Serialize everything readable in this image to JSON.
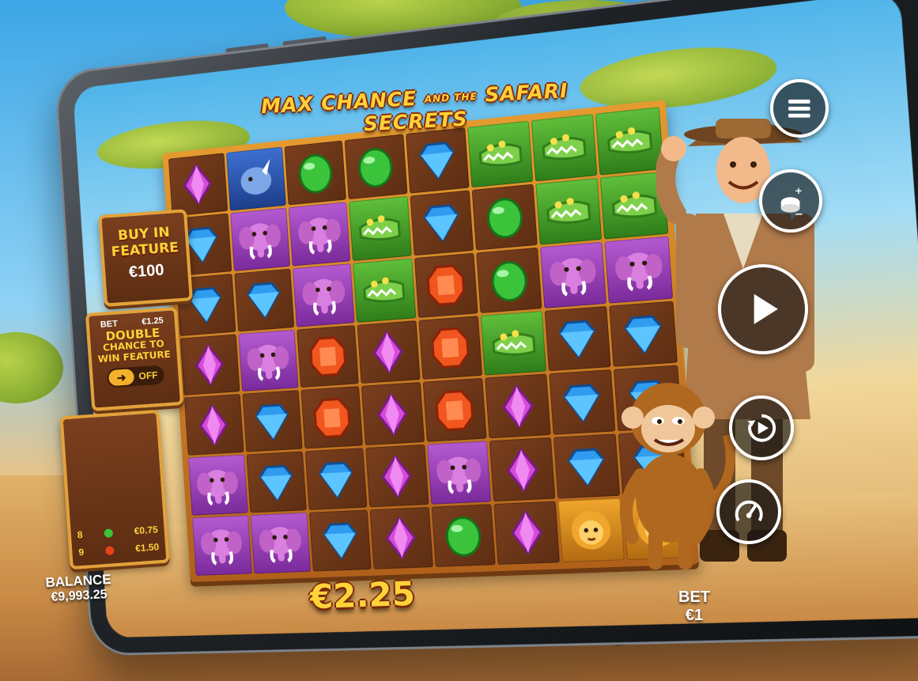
{
  "game": {
    "title_main": "MAX CHANCE",
    "title_and": "AND THE",
    "title_sub": "SAFARI SECRETS"
  },
  "buy_feature": {
    "label": "BUY IN FEATURE",
    "price": "€100"
  },
  "double_chance": {
    "bet_label": "BET",
    "bet_value": "€1.25",
    "label_line1": "DOUBLE",
    "label_line2": "CHANCE TO",
    "label_line3": "WIN FEATURE",
    "toggle_state": "OFF"
  },
  "paytable": {
    "rows": [
      {
        "count": "8",
        "gem": "green",
        "value": "€0.75"
      },
      {
        "count": "9",
        "gem": "red",
        "value": "€1.50"
      }
    ]
  },
  "hud": {
    "balance_label": "BALANCE",
    "balance_value": "€9,993.25",
    "win_value": "€2.25",
    "bet_label": "BET",
    "bet_value": "€1"
  },
  "controls": [
    {
      "name": "menu-button",
      "icon": "hamburger-icon"
    },
    {
      "name": "bet-adjust-button",
      "icon": "coin-stack-icon"
    },
    {
      "name": "spin-button",
      "icon": "play-icon"
    },
    {
      "name": "autoplay-button",
      "icon": "autoplay-icon"
    },
    {
      "name": "turbo-button",
      "icon": "speedometer-icon"
    }
  ],
  "grid": {
    "rows": [
      [
        "purple",
        "rhino",
        "green",
        "green",
        "blue",
        "croc",
        "croc",
        "croc"
      ],
      [
        "blue",
        "elephant",
        "elephant",
        "croc",
        "blue",
        "green",
        "croc",
        "croc"
      ],
      [
        "blue",
        "blue",
        "elephant",
        "croc",
        "red",
        "green",
        "elephant",
        "elephant"
      ],
      [
        "purple",
        "elephant",
        "red",
        "purple",
        "red",
        "croc",
        "blue",
        "blue"
      ],
      [
        "purple",
        "blue",
        "red",
        "purple",
        "red",
        "purple",
        "blue",
        "blue"
      ],
      [
        "elephant",
        "blue",
        "blue",
        "purple",
        "elephant",
        "purple",
        "blue",
        "blue"
      ],
      [
        "elephant",
        "elephant",
        "blue",
        "purple",
        "green",
        "purple",
        "lion",
        "lion"
      ]
    ]
  },
  "colors": {
    "gold": "#ffd23a",
    "panel_brown": "#5d2d12",
    "frame_orange": "#e3a13a"
  }
}
